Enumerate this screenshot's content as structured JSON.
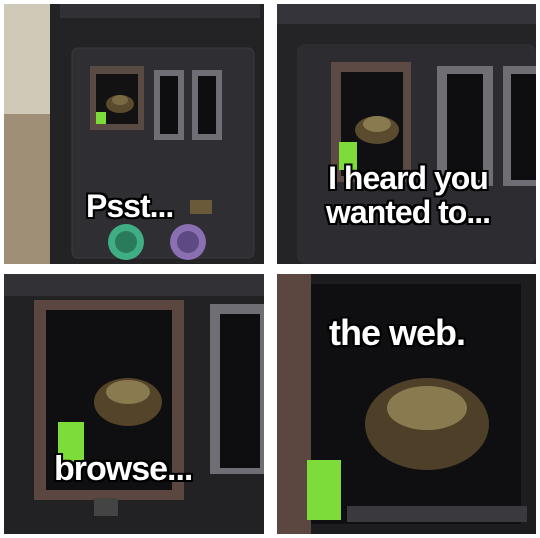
{
  "panels": [
    {
      "caption": "Psst..."
    },
    {
      "caption_line1": "I heard you",
      "caption_line2": "wanted to..."
    },
    {
      "caption": "browse..."
    },
    {
      "caption": "the web."
    }
  ],
  "colors": {
    "case": "#2a2a2c",
    "port_trim": "#6e5a52",
    "led_green": "#7ddc3a",
    "ps2_green": "#3fae84",
    "ps2_purple": "#8a6fb3"
  }
}
